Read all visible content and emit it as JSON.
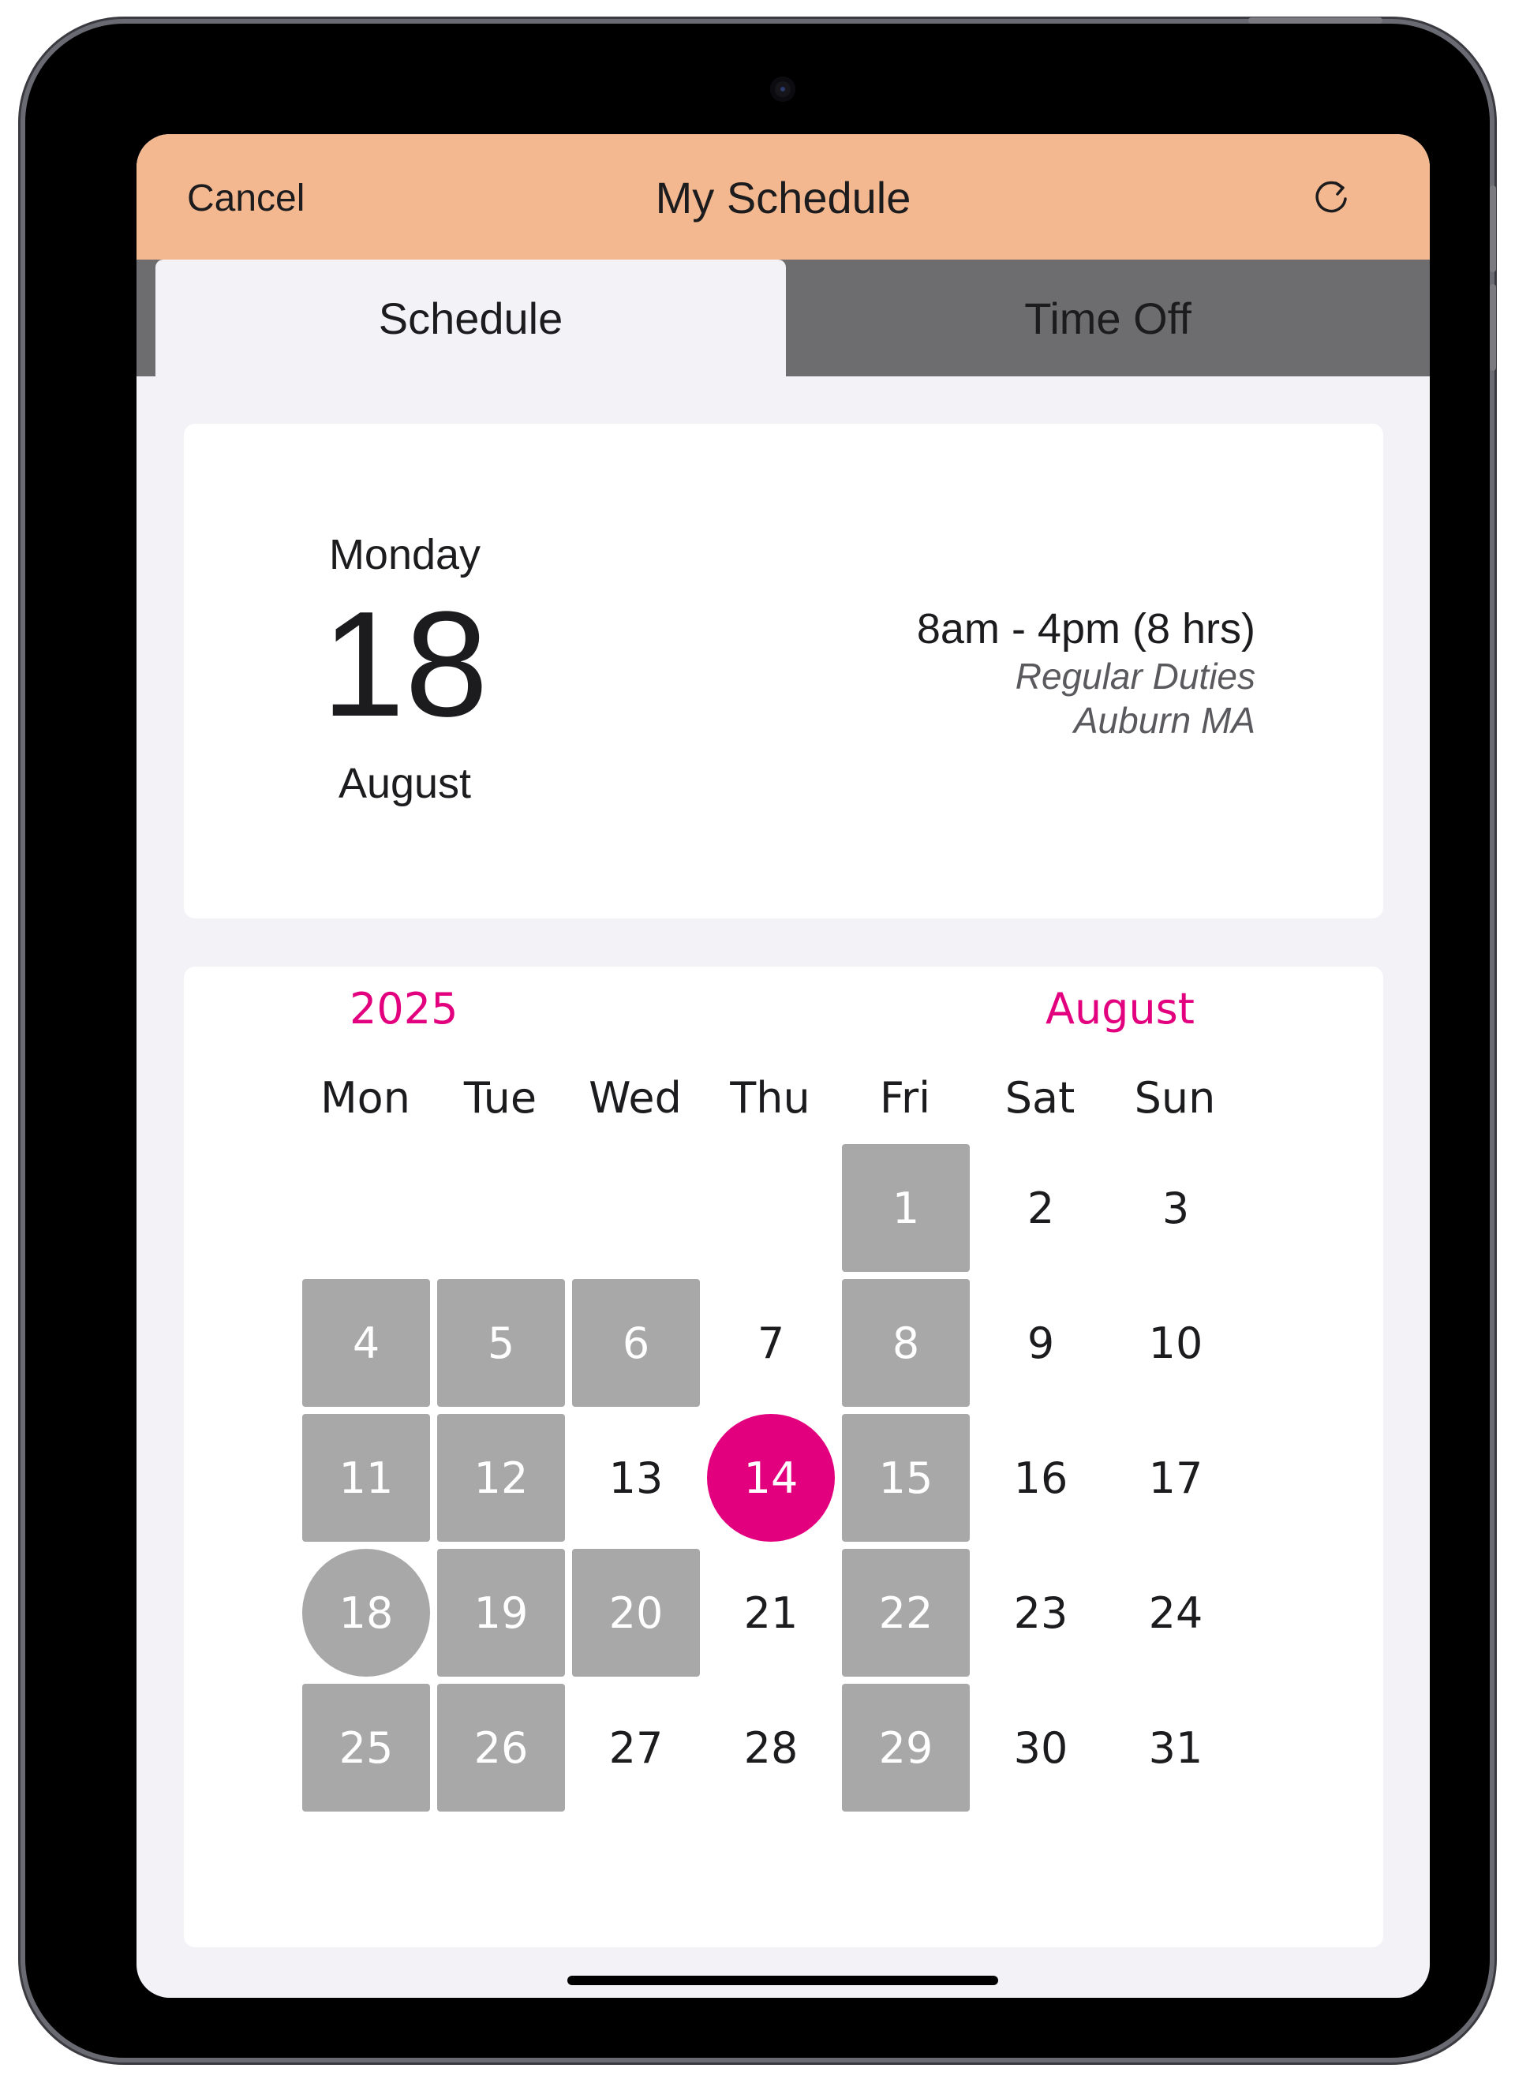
{
  "navbar": {
    "cancel_label": "Cancel",
    "title": "My Schedule",
    "refresh_icon": "refresh-icon",
    "background_color": "#f3b88f"
  },
  "tabs": [
    {
      "label": "Schedule",
      "selected": true
    },
    {
      "label": "Time Off",
      "selected": false
    }
  ],
  "selected_day": {
    "weekday": "Monday",
    "day": "18",
    "month": "August",
    "shift_time": "8am - 4pm (8 hrs)",
    "duty": "Regular Duties",
    "location": "Auburn MA"
  },
  "calendar": {
    "year": "2025",
    "month": "August",
    "accent_color": "#e3007f",
    "scheduled_color": "#a8a8a8",
    "weekdays": [
      "Mon",
      "Tue",
      "Wed",
      "Thu",
      "Fri",
      "Sat",
      "Sun"
    ],
    "weeks": [
      [
        null,
        null,
        null,
        null,
        {
          "n": "1",
          "s": "sched"
        },
        {
          "n": "2",
          "s": ""
        },
        {
          "n": "3",
          "s": ""
        }
      ],
      [
        {
          "n": "4",
          "s": "sched"
        },
        {
          "n": "5",
          "s": "sched"
        },
        {
          "n": "6",
          "s": "sched"
        },
        {
          "n": "7",
          "s": ""
        },
        {
          "n": "8",
          "s": "sched"
        },
        {
          "n": "9",
          "s": ""
        },
        {
          "n": "10",
          "s": ""
        }
      ],
      [
        {
          "n": "11",
          "s": "sched"
        },
        {
          "n": "12",
          "s": "sched"
        },
        {
          "n": "13",
          "s": ""
        },
        {
          "n": "14",
          "s": "today"
        },
        {
          "n": "15",
          "s": "sched"
        },
        {
          "n": "16",
          "s": ""
        },
        {
          "n": "17",
          "s": ""
        }
      ],
      [
        {
          "n": "18",
          "s": "selected"
        },
        {
          "n": "19",
          "s": "sched"
        },
        {
          "n": "20",
          "s": "sched"
        },
        {
          "n": "21",
          "s": ""
        },
        {
          "n": "22",
          "s": "sched"
        },
        {
          "n": "23",
          "s": ""
        },
        {
          "n": "24",
          "s": ""
        }
      ],
      [
        {
          "n": "25",
          "s": "sched"
        },
        {
          "n": "26",
          "s": "sched"
        },
        {
          "n": "27",
          "s": ""
        },
        {
          "n": "28",
          "s": ""
        },
        {
          "n": "29",
          "s": "sched"
        },
        {
          "n": "30",
          "s": ""
        },
        {
          "n": "31",
          "s": ""
        }
      ]
    ]
  }
}
